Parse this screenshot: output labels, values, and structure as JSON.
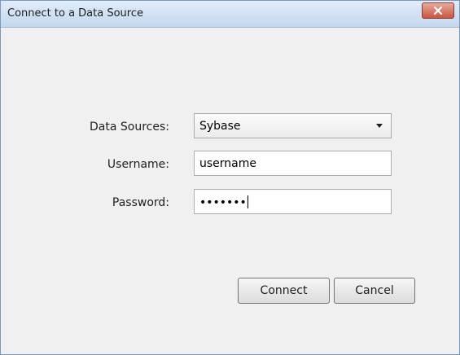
{
  "window": {
    "title": "Connect to a Data Source",
    "close_icon": "close-icon"
  },
  "form": {
    "data_sources_label": "Data Sources:",
    "data_sources_value": "Sybase",
    "username_label": "Username:",
    "username_value": "username",
    "password_label": "Password:",
    "password_value": "•••••••"
  },
  "buttons": {
    "connect_label": "Connect",
    "cancel_label": "Cancel"
  },
  "colors": {
    "titlebar": "#c4d8ee",
    "close_button": "#c8553f",
    "dialog_background": "#f0f0f0"
  }
}
